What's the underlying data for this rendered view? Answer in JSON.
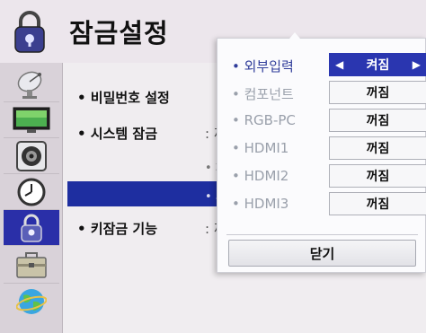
{
  "header": {
    "title": "잠금설정",
    "icon": "lock-icon"
  },
  "sidebar": {
    "items": [
      {
        "icon": "satellite-dish-icon"
      },
      {
        "icon": "tv-screen-icon"
      },
      {
        "icon": "speaker-icon"
      },
      {
        "icon": "clock-icon"
      },
      {
        "icon": "lock-icon",
        "active": true
      },
      {
        "icon": "toolbox-icon"
      },
      {
        "icon": "globe-icon"
      }
    ]
  },
  "main": {
    "items": [
      {
        "label": "• 비밀번호 설정"
      },
      {
        "label": "• 시스템 잠금",
        "value": ": 꺼"
      },
      {
        "label": "• 키잠금 기능",
        "value": ": 꺼"
      }
    ],
    "sub_items": [
      {
        "label": "• 차"
      },
      {
        "label": "• 외"
      }
    ]
  },
  "popup": {
    "rows": [
      {
        "label": "• 외부입력",
        "value": "켜짐",
        "active": true
      },
      {
        "label": "• 컴포넌트",
        "value": "꺼짐"
      },
      {
        "label": "• RGB-PC",
        "value": "꺼짐"
      },
      {
        "label": "• HDMI1",
        "value": "꺼짐"
      },
      {
        "label": "• HDMI2",
        "value": "꺼짐"
      },
      {
        "label": "• HDMI3",
        "value": "꺼짐"
      }
    ],
    "close_label": "닫기"
  },
  "colors": {
    "accent": "#2a36b0",
    "highlight_bar": "#1e2ea0"
  }
}
